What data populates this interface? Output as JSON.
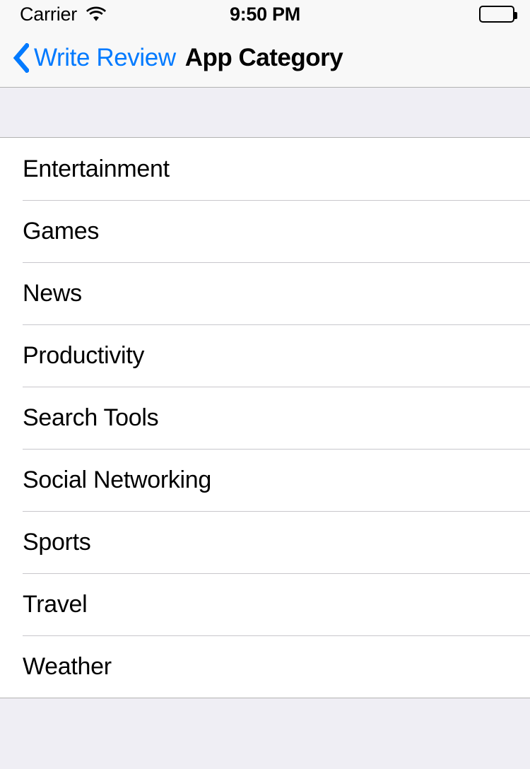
{
  "status_bar": {
    "carrier": "Carrier",
    "wifi_icon": "wifi-icon",
    "time": "9:50 PM",
    "battery_icon": "battery-full-icon"
  },
  "nav_bar": {
    "back_icon": "chevron-left-icon",
    "back_label": "Write Review",
    "title": "App Category"
  },
  "list": {
    "rows": [
      {
        "label": "Entertainment"
      },
      {
        "label": "Games"
      },
      {
        "label": "News"
      },
      {
        "label": "Productivity"
      },
      {
        "label": "Search Tools"
      },
      {
        "label": "Social Networking"
      },
      {
        "label": "Sports"
      },
      {
        "label": "Travel"
      },
      {
        "label": "Weather"
      }
    ]
  },
  "colors": {
    "tint": "#027AFF",
    "bar_background": "#F8F8F8",
    "group_background": "#EFEEF4",
    "row_background": "#FFFFFF",
    "separator": "#C8C7CC",
    "text": "#000000"
  }
}
